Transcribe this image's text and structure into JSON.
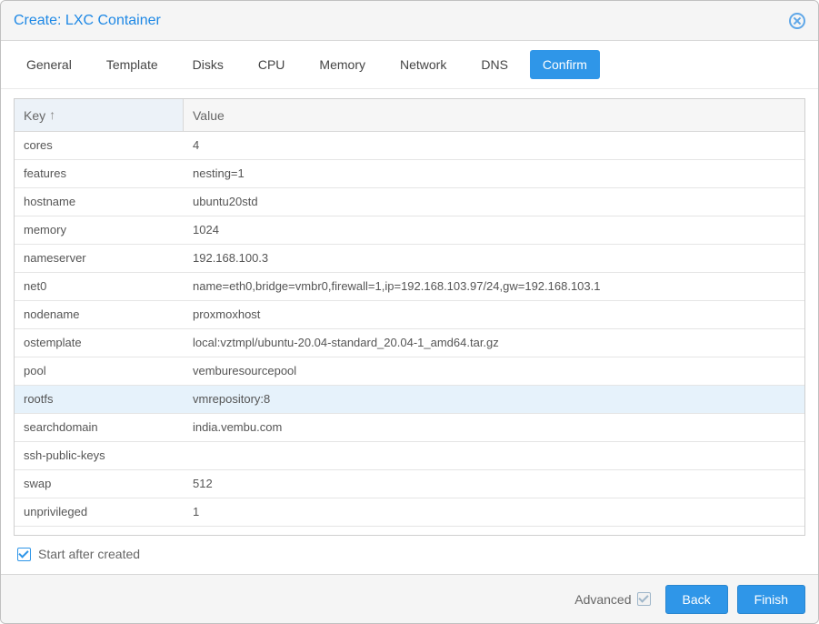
{
  "window": {
    "title": "Create: LXC Container"
  },
  "tabs": [
    {
      "label": "General",
      "active": false
    },
    {
      "label": "Template",
      "active": false
    },
    {
      "label": "Disks",
      "active": false
    },
    {
      "label": "CPU",
      "active": false
    },
    {
      "label": "Memory",
      "active": false
    },
    {
      "label": "Network",
      "active": false
    },
    {
      "label": "DNS",
      "active": false
    },
    {
      "label": "Confirm",
      "active": true
    }
  ],
  "grid": {
    "header": {
      "key": "Key",
      "value": "Value",
      "sort_icon": "↑"
    },
    "rows": [
      {
        "key": "cores",
        "value": "4"
      },
      {
        "key": "features",
        "value": "nesting=1"
      },
      {
        "key": "hostname",
        "value": "ubuntu20std"
      },
      {
        "key": "memory",
        "value": "1024"
      },
      {
        "key": "nameserver",
        "value": "192.168.100.3"
      },
      {
        "key": "net0",
        "value": "name=eth0,bridge=vmbr0,firewall=1,ip=192.168.103.97/24,gw=192.168.103.1"
      },
      {
        "key": "nodename",
        "value": "proxmoxhost"
      },
      {
        "key": "ostemplate",
        "value": "local:vztmpl/ubuntu-20.04-standard_20.04-1_amd64.tar.gz"
      },
      {
        "key": "pool",
        "value": "vemburesourcepool"
      },
      {
        "key": "rootfs",
        "value": "vmrepository:8",
        "selected": true
      },
      {
        "key": "searchdomain",
        "value": "india.vembu.com"
      },
      {
        "key": "ssh-public-keys",
        "value": ""
      },
      {
        "key": "swap",
        "value": "512"
      },
      {
        "key": "unprivileged",
        "value": "1"
      }
    ]
  },
  "start_after": {
    "label": "Start after created",
    "checked": true
  },
  "footer": {
    "advanced_label": "Advanced",
    "advanced_checked": true,
    "back": "Back",
    "finish": "Finish"
  }
}
